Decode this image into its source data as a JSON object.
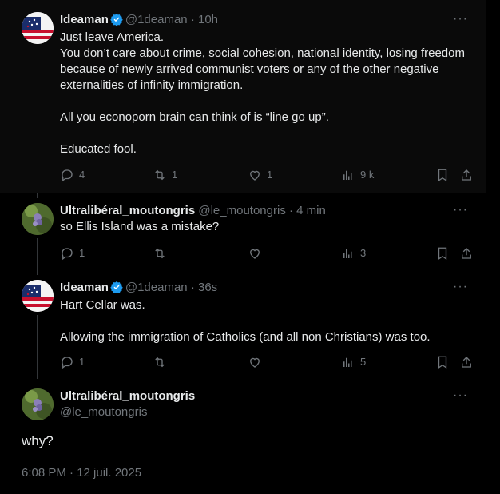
{
  "tweets": [
    {
      "name": "Ideaman",
      "handle": "@1deaman",
      "time": "10h",
      "verified": true,
      "text": "Just leave America.\nYou don’t care about crime, social cohesion, national identity, losing freedom because of newly arrived communist voters or any of the other negative externalities of infinity immigration.\n\nAll you econoporn brain can think of is “line go up”.\n\nEducated fool.",
      "replies": "4",
      "reposts": "1",
      "likes": "1",
      "views": "9 k"
    },
    {
      "name": "Ultralibéral_moutongris",
      "handle": "@le_moutongris",
      "time": "4 min",
      "verified": false,
      "text": "so Ellis Island was a mistake?",
      "replies": "1",
      "reposts": "",
      "likes": "",
      "views": "3"
    },
    {
      "name": "Ideaman",
      "handle": "@1deaman",
      "time": "36s",
      "verified": true,
      "text": "Hart Cellar was.\n\nAllowing the immigration of Catholics (and all non Christians) was too.",
      "replies": "1",
      "reposts": "",
      "likes": "",
      "views": "5"
    }
  ],
  "main": {
    "name": "Ultralibéral_moutongris",
    "handle": "@le_moutongris",
    "text": "why?",
    "timestamp": "6:08 PM · 12 juil. 2025"
  },
  "sep": "·",
  "more_label": "···",
  "colors": {
    "accent": "#1d9bf0",
    "muted": "#71767b",
    "text": "#e7e9ea"
  }
}
